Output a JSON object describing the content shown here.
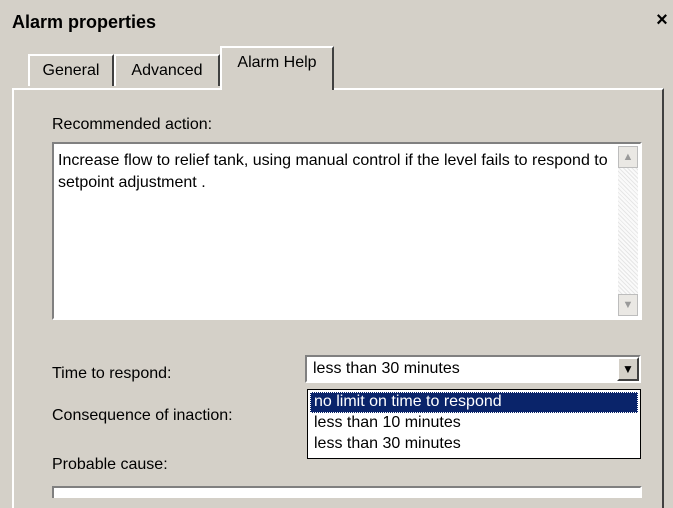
{
  "window": {
    "title": "Alarm properties",
    "close_icon": "close-icon"
  },
  "tabs": [
    {
      "label": "General",
      "active": false
    },
    {
      "label": "Advanced",
      "active": false
    },
    {
      "label": "Alarm Help",
      "active": true
    }
  ],
  "alarm_help": {
    "recommended_action_label": "Recommended action:",
    "recommended_action_text": "Increase flow to relief tank, using manual control if the level fails to respond to setpoint adjustment .",
    "time_to_respond_label": "Time to respond:",
    "time_to_respond_value": "less than 30 minutes",
    "time_options": [
      "no limit on time to respond",
      "less than 10 minutes",
      "less than 30 minutes"
    ],
    "highlighted_option": "no limit on time to respond",
    "consequence_label": "Consequence of inaction:",
    "probable_cause_label": "Probable cause:"
  }
}
